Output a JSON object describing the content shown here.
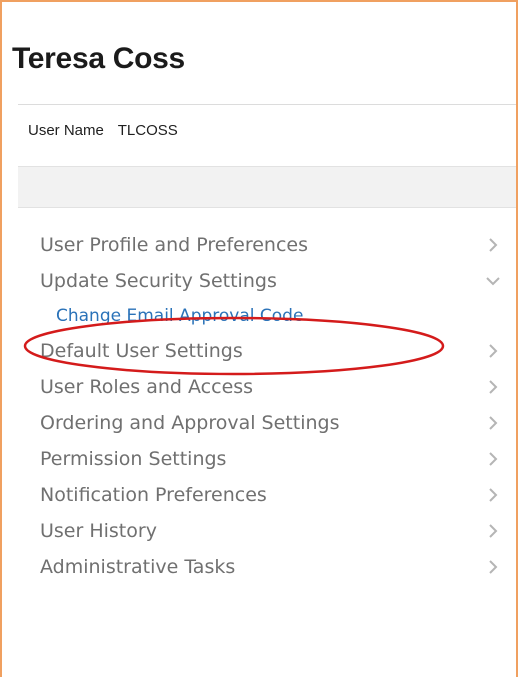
{
  "profile": {
    "full_name": "Teresa Coss",
    "username_label": "User Name",
    "username_value": "TLCOSS"
  },
  "menu": [
    {
      "label": "User Profile and Preferences",
      "state": "collapsed"
    },
    {
      "label": "Update Security Settings",
      "state": "expanded"
    },
    {
      "label": "Change Email Approval Code",
      "state": "subitem"
    },
    {
      "label": "Default User Settings",
      "state": "collapsed"
    },
    {
      "label": "User Roles and Access",
      "state": "collapsed"
    },
    {
      "label": "Ordering and Approval Settings",
      "state": "collapsed"
    },
    {
      "label": "Permission Settings",
      "state": "collapsed"
    },
    {
      "label": "Notification Preferences",
      "state": "collapsed"
    },
    {
      "label": "User History",
      "state": "collapsed"
    },
    {
      "label": "Administrative Tasks",
      "state": "collapsed"
    }
  ],
  "annotation": {
    "shape": "ellipse",
    "color": "#d41b1b",
    "target": "Change Email Approval Code"
  },
  "colors": {
    "frame_border": "#f0a060",
    "menu_text": "#707070",
    "link_text": "#2a72b8",
    "chevron": "#b5b5b5"
  }
}
